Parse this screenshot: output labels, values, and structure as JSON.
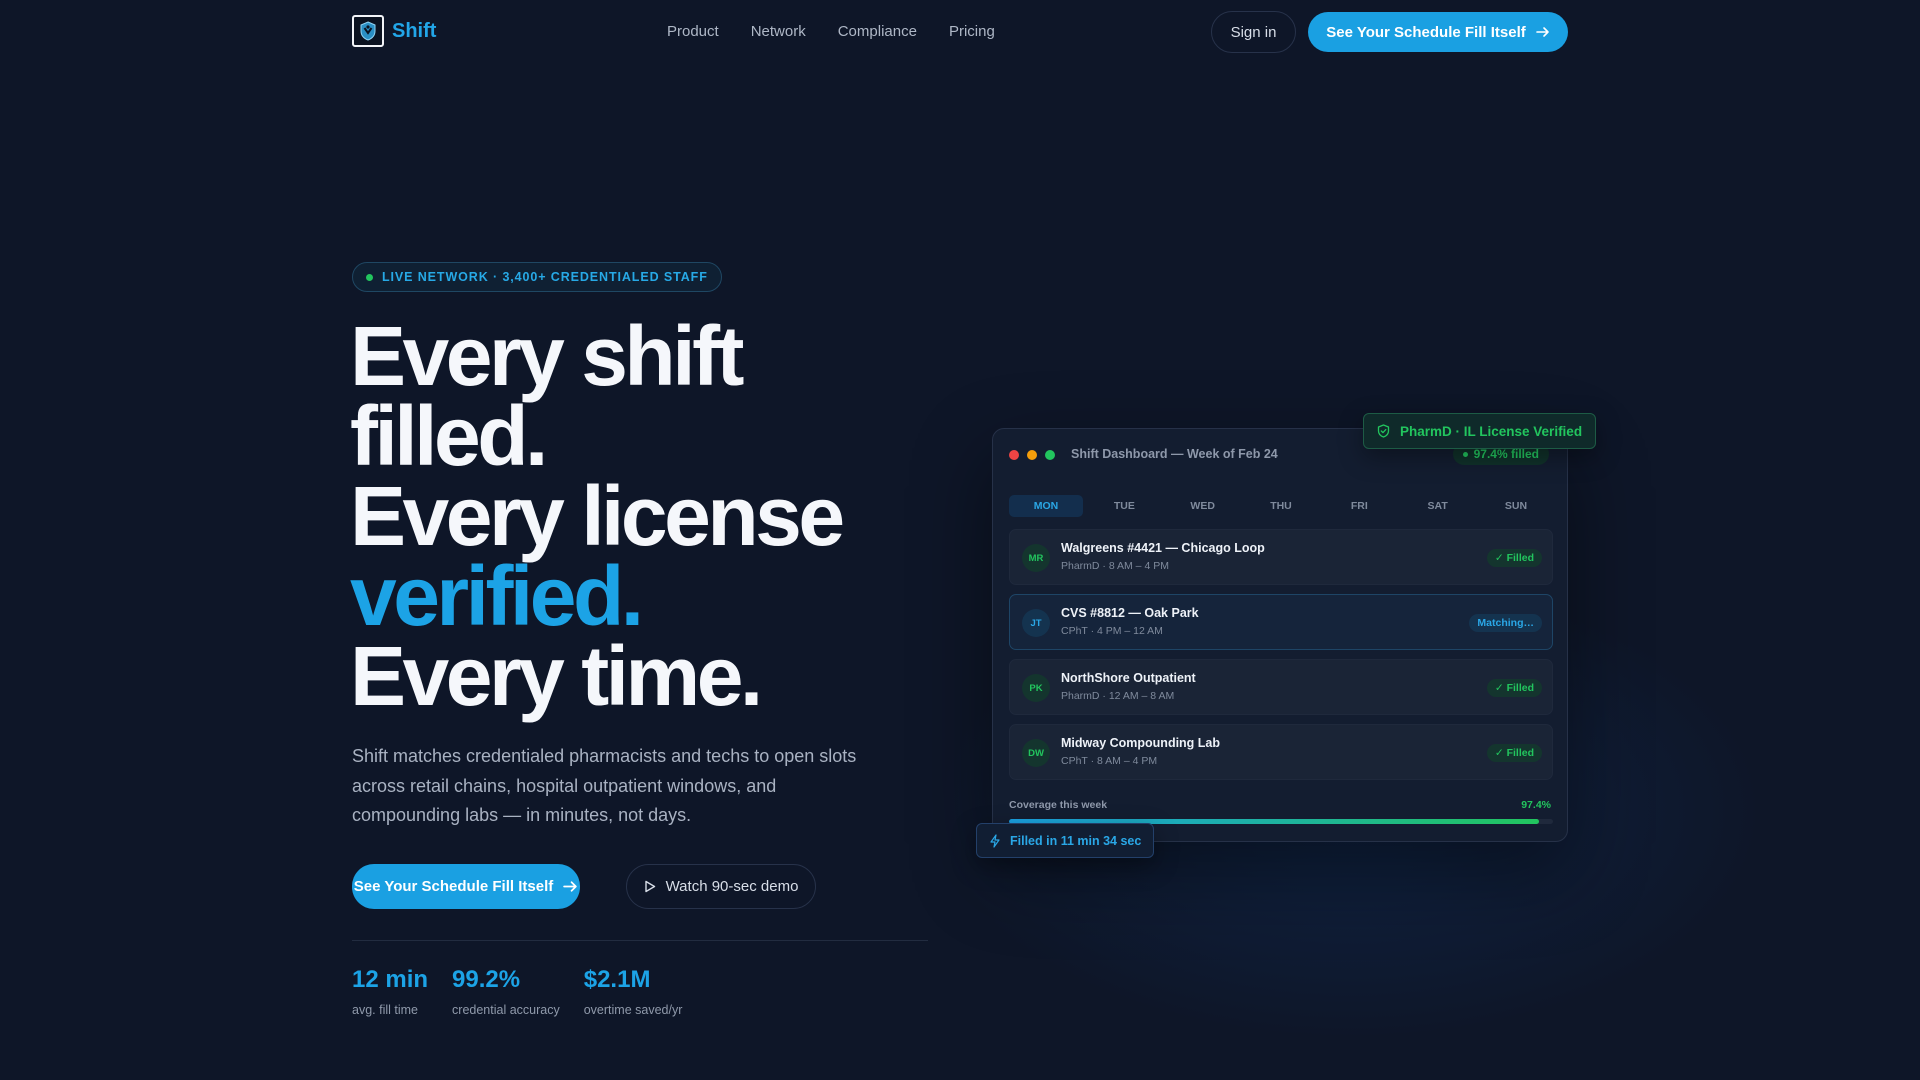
{
  "brand": {
    "name": "Shift",
    "logo_icon": "shield-logo-icon"
  },
  "nav": {
    "links": [
      "Product",
      "Network",
      "Compliance",
      "Pricing"
    ],
    "signin_label": "Sign in",
    "cta_label": "See Your Schedule Fill Itself"
  },
  "hero": {
    "pill": "LIVE NETWORK · 3,400+ CREDENTIALED STAFF",
    "headline": {
      "line1": "Every shift",
      "line2": "filled.",
      "line3": "Every license",
      "line4": "verified.",
      "line5": "Every time."
    },
    "subcopy": "Shift matches credentialed pharmacists and techs to open slots across retail chains, hospital outpatient windows, and compounding labs — in minutes, not days.",
    "cta_label": "See Your Schedule Fill Itself",
    "demo_label": "Watch 90-sec demo"
  },
  "stats": [
    {
      "value": "12 min",
      "label": "avg. fill time"
    },
    {
      "value": "99.2%",
      "label": "credential accuracy"
    },
    {
      "value": "$2.1M",
      "label": "overtime saved/yr"
    }
  ],
  "dashboard": {
    "title": "Shift Dashboard — Week of Feb 24",
    "badge": "97.4% filled",
    "days": [
      "MON",
      "TUE",
      "WED",
      "THU",
      "FRI",
      "SAT",
      "SUN"
    ],
    "active_day": "MON",
    "shifts": [
      {
        "initials": "MR",
        "name": "Walgreens #4421 — Chicago Loop",
        "detail": "PharmD · 8 AM – 4 PM",
        "status": "✓ Filled",
        "state": "filled"
      },
      {
        "initials": "JT",
        "name": "CVS #8812 — Oak Park",
        "detail": "CPhT · 4 PM – 12 AM",
        "status": "Matching…",
        "state": "matching"
      },
      {
        "initials": "PK",
        "name": "NorthShore Outpatient",
        "detail": "PharmD · 12 AM – 8 AM",
        "status": "✓ Filled",
        "state": "filled"
      },
      {
        "initials": "DW",
        "name": "Midway Compounding Lab",
        "detail": "CPhT · 8 AM – 4 PM",
        "status": "✓ Filled",
        "state": "filled"
      }
    ],
    "coverage_label": "Coverage this week",
    "coverage_value": "97.4%",
    "coverage_fraction": 0.974
  },
  "chips": {
    "verified": "PharmD · IL License Verified",
    "fill_time": "Filled in 11 min 34 sec"
  },
  "colors": {
    "accent": "#1ca3e6",
    "success": "#22c55e",
    "background": "#0e1628"
  }
}
